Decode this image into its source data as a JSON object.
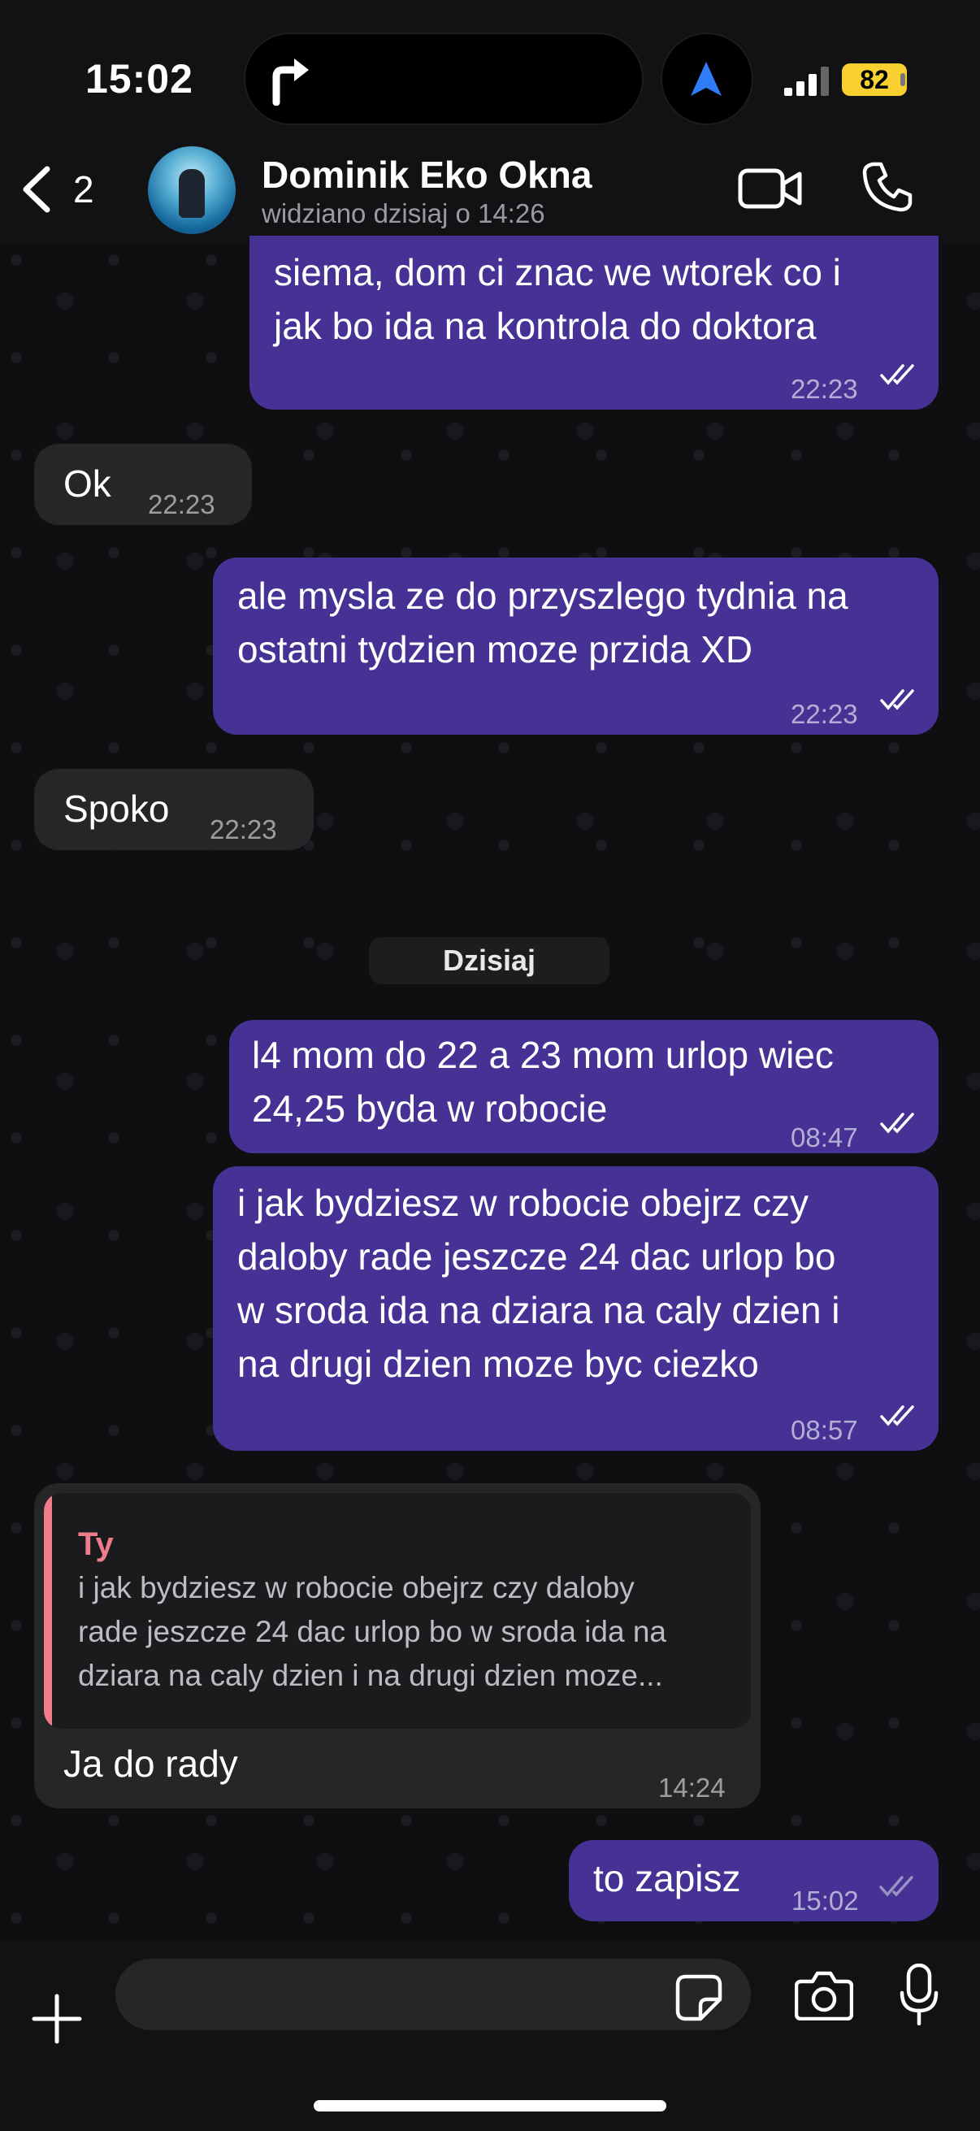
{
  "status_bar": {
    "time": "15:02",
    "battery": "82"
  },
  "header": {
    "back_count": "2",
    "contact_name": "Dominik Eko Okna",
    "contact_status": "widziano dzisiaj o 14:26"
  },
  "messages": [
    {
      "direction": "outgoing",
      "text": "siema, dom ci znac we wtorek co i\njak bo ida na kontrola do doktora",
      "time": "22:23",
      "status": "read"
    },
    {
      "direction": "incoming",
      "text": "Ok",
      "time": "22:23"
    },
    {
      "direction": "outgoing",
      "text": "ale mysla ze do przyszlego tydnia na\nostatni tydzien moze przida XD",
      "time": "22:23",
      "status": "read"
    },
    {
      "direction": "incoming",
      "text": "Spoko",
      "time": "22:23"
    },
    {
      "direction": "outgoing",
      "text": "l4 mom do 22 a 23 mom urlop wiec\n24,25 byda w robocie",
      "time": "08:47",
      "status": "read"
    },
    {
      "direction": "outgoing",
      "text": "i jak bydziesz w robocie obejrz czy\ndaloby rade jeszcze 24 dac urlop bo\nw sroda ida na dziara na caly dzien i\nna drugi dzien moze byc ciezko",
      "time": "08:57",
      "status": "read"
    },
    {
      "direction": "incoming",
      "reply_to": {
        "author": "Ty",
        "text": "i jak bydziesz w robocie obejrz czy daloby\nrade jeszcze 24 dac urlop bo w sroda ida na\ndziara na caly dzien i na drugi dzien moze..."
      },
      "text": "Ja do rady",
      "time": "14:24"
    },
    {
      "direction": "outgoing",
      "text": "to zapisz",
      "time": "15:02",
      "status": "delivered"
    }
  ],
  "date_separator": "Dzisiaj",
  "composer": {
    "placeholder": ""
  },
  "colors": {
    "outgoing_bubble": "#453294",
    "incoming_bubble": "#262628",
    "reply_accent": "#ee7c8a",
    "battery": "#f8d030"
  },
  "icons": [
    "turn-right-icon",
    "navigation-arrow-icon",
    "signal-icon",
    "back-chevron-icon",
    "video-call-icon",
    "phone-icon",
    "plus-icon",
    "sticker-icon",
    "camera-icon",
    "microphone-icon",
    "double-check-icon"
  ]
}
